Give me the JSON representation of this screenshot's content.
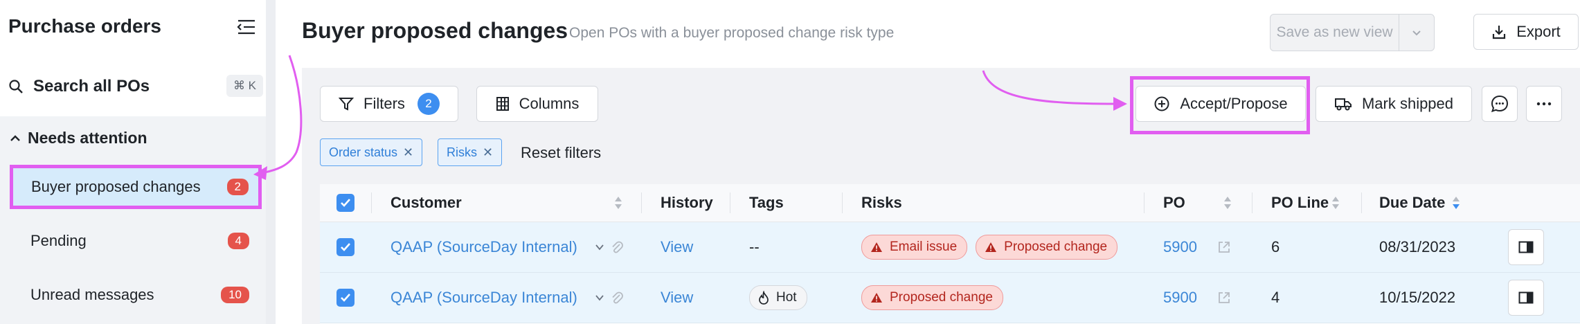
{
  "sidebar": {
    "title": "Purchase orders",
    "search_label": "Search all POs",
    "search_shortcut": "⌘ K",
    "section_label": "Needs attention",
    "items": [
      {
        "label": "Buyer proposed changes",
        "count": "2"
      },
      {
        "label": "Pending",
        "count": "4"
      },
      {
        "label": "Unread messages",
        "count": "10"
      }
    ]
  },
  "header": {
    "title": "Buyer proposed changes",
    "subtitle": "Open POs with a buyer proposed change risk type",
    "save_view_label": "Save as new view",
    "export_label": "Export"
  },
  "toolbar": {
    "filters_label": "Filters",
    "filters_count": "2",
    "columns_label": "Columns",
    "accept_label": "Accept/Propose",
    "mark_shipped_label": "Mark shipped"
  },
  "filters": {
    "chips": [
      "Order status",
      "Risks"
    ],
    "reset_label": "Reset filters"
  },
  "table": {
    "columns": [
      "Customer",
      "History",
      "Tags",
      "Risks",
      "PO",
      "PO Line",
      "Due Date"
    ],
    "rows": [
      {
        "customer": "QAAP (SourceDay Internal)",
        "history": "View",
        "tags": "--",
        "risks": [
          "Email issue",
          "Proposed change"
        ],
        "po": "5900",
        "po_line": "6",
        "due_date": "08/31/2023"
      },
      {
        "customer": "QAAP (SourceDay Internal)",
        "history": "View",
        "tags": "Hot",
        "risks": [
          "Proposed change"
        ],
        "po": "5900",
        "po_line": "4",
        "due_date": "10/15/2022"
      }
    ]
  },
  "colors": {
    "accent": "#3d8ef0",
    "annotation": "#e15ef0",
    "danger": "#e5534b"
  }
}
